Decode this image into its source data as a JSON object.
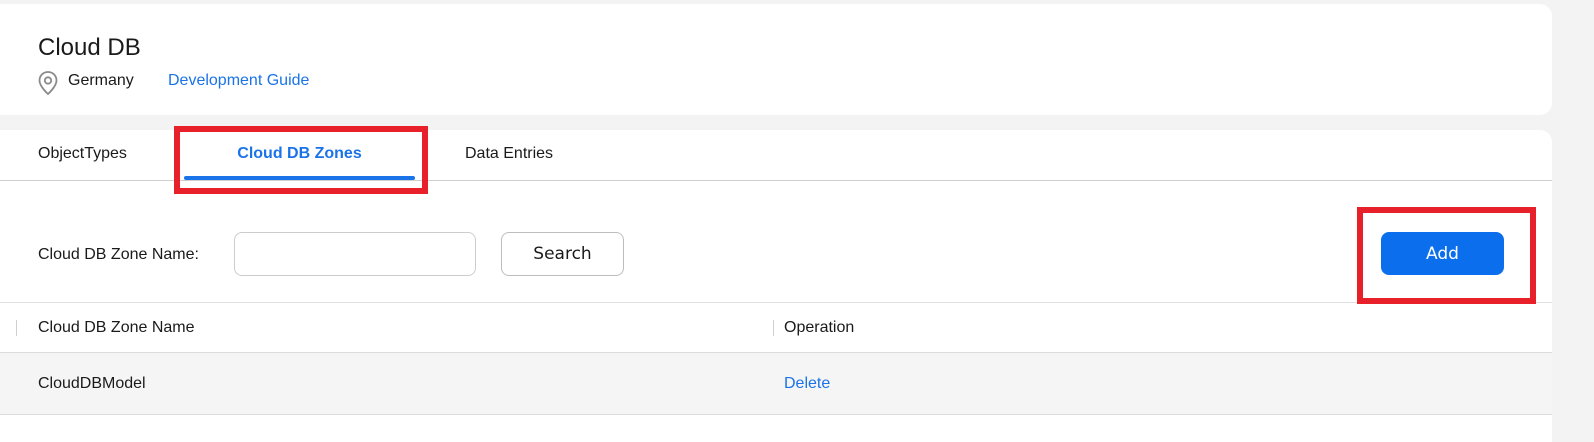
{
  "header": {
    "title": "Cloud DB",
    "region": "Germany",
    "dev_guide_link": "Development Guide"
  },
  "tabs": [
    {
      "label": "ObjectTypes",
      "active": false
    },
    {
      "label": "Cloud DB Zones",
      "active": true
    },
    {
      "label": "Data Entries",
      "active": false
    }
  ],
  "filter": {
    "label": "Cloud DB Zone Name:",
    "input_value": "",
    "search_label": "Search"
  },
  "toolbar": {
    "add_label": "Add"
  },
  "table": {
    "columns": [
      "Cloud DB Zone Name",
      "Operation"
    ],
    "rows": [
      {
        "name": "CloudDBModel",
        "operation": "Delete"
      }
    ]
  },
  "colors": {
    "accent": "#1a73e8",
    "primary_button": "#0a6eed",
    "highlight": "#e8202a"
  },
  "icons": {
    "location": "location-pin-icon"
  }
}
